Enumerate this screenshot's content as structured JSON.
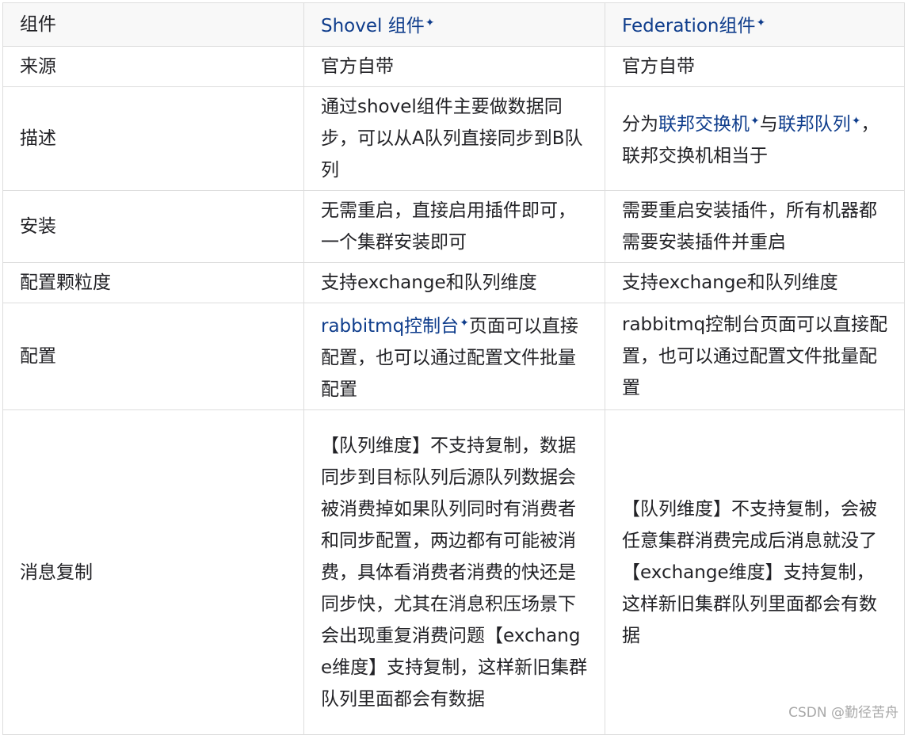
{
  "table": {
    "header": {
      "col1": "组件",
      "col2": "Shovel 组件",
      "col3": "Federation组件",
      "link_mark": "✦"
    },
    "rows": [
      {
        "label": "来源",
        "shovel": "官方自带",
        "federation": "官方自带"
      },
      {
        "label": "描述",
        "shovel": "通过shovel组件主要做数据同步，可以从A队列直接同步到B队列",
        "federation_prefix": "分为",
        "federation_link1": "联邦交换机",
        "federation_mid": "与",
        "federation_link2": "联邦队列",
        "federation_suffix": "，联邦交换机相当于"
      },
      {
        "label": "安装",
        "shovel": "无需重启，直接启用插件即可，一个集群安装即可",
        "federation": "需要重启安装插件，所有机器都需要安装插件并重启"
      },
      {
        "label": "配置颗粒度",
        "shovel": "支持exchange和队列维度",
        "federation": "支持exchange和队列维度"
      },
      {
        "label": "配置",
        "shovel_link": "rabbitmq控制台",
        "shovel_suffix": "页面可以直接配置，也可以通过配置文件批量配置",
        "federation": "rabbitmq控制台页面可以直接配置，也可以通过配置文件批量配置"
      },
      {
        "label": "消息复制",
        "shovel": "【队列维度】不支持复制，数据同步到目标队列后源队列数据会被消费掉如果队列同时有消费者和同步配置，两边都有可能被消费，具体看消费者消费的快还是同步快，尤其在消息积压场景下会出现重复消费问题【exchange维度】支持复制，这样新旧集群队列里面都会有数据",
        "federation": "【队列维度】不支持复制，会被任意集群消费完成后消息就没了【exchange维度】支持复制，这样新旧集群队列里面都会有数据"
      }
    ]
  },
  "watermark": "CSDN @勤径苦舟",
  "colors": {
    "link": "#0f3d8c",
    "border": "#dddddd",
    "header_bg": "#f8f8f8",
    "text": "#222226"
  }
}
